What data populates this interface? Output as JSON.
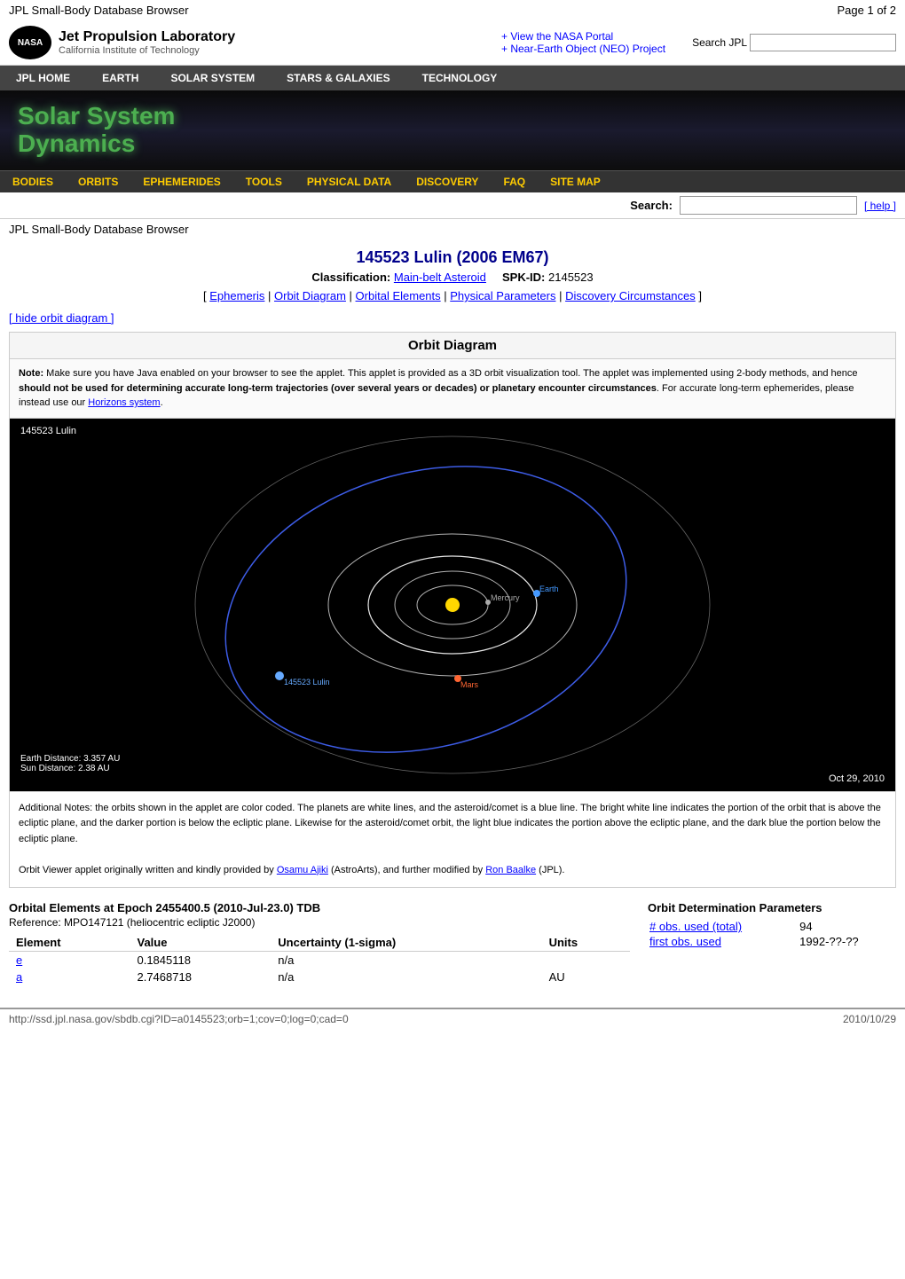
{
  "header": {
    "page_title": "JPL Small-Body Database Browser",
    "page_num": "Page 1 of 2",
    "nasa_label": "NASA",
    "jpl_main": "Jet Propulsion Laboratory",
    "jpl_sub": "California Institute of Technology",
    "nasa_link1": "+ View the NASA Portal",
    "nasa_link2": "+ Near-Earth Object (NEO) Project",
    "search_jpl_label": "Search JPL"
  },
  "main_nav": {
    "items": [
      {
        "label": "JPL HOME",
        "href": "#"
      },
      {
        "label": "EARTH",
        "href": "#"
      },
      {
        "label": "SOLAR SYSTEM",
        "href": "#"
      },
      {
        "label": "STARS & GALAXIES",
        "href": "#"
      },
      {
        "label": "TECHNOLOGY",
        "href": "#"
      }
    ]
  },
  "banner": {
    "title_line1": "Solar System",
    "title_line2": "Dynamics"
  },
  "sub_nav": {
    "items": [
      {
        "label": "BODIES",
        "href": "#"
      },
      {
        "label": "ORBITS",
        "href": "#"
      },
      {
        "label": "EPHEMERIDES",
        "href": "#"
      },
      {
        "label": "TOOLS",
        "href": "#"
      },
      {
        "label": "PHYSICAL DATA",
        "href": "#"
      },
      {
        "label": "DISCOVERY",
        "href": "#"
      },
      {
        "label": "FAQ",
        "href": "#"
      },
      {
        "label": "SITE MAP",
        "href": "#"
      }
    ]
  },
  "search_bar": {
    "label": "Search:",
    "help_link": "[ help ]"
  },
  "breadcrumb": "JPL Small-Body Database Browser",
  "asteroid": {
    "title": "145523 Lulin (2006 EM67)",
    "classification_label": "Classification:",
    "classification_value": "Main-belt Asteroid",
    "spk_label": "SPK-ID:",
    "spk_value": "2145523",
    "nav_links": [
      {
        "label": "Ephemeris"
      },
      {
        "label": "Orbit Diagram"
      },
      {
        "label": "Orbital Elements"
      },
      {
        "label": "Physical Parameters"
      },
      {
        "label": "Discovery Circumstances"
      }
    ]
  },
  "orbit_diagram": {
    "hide_link": "[ hide orbit diagram ]",
    "title": "Orbit Diagram",
    "note": "Note: Make sure you have Java enabled on your browser to see the applet. This applet is provided as a 3D orbit visualization tool. The applet was implemented using 2-body methods, and hence should not be used for determining accurate long-term trajectories (over several years or decades) or planetary encounter circumstances. For accurate long-term ephemerides, please instead use our Horizons system.",
    "horizons_link": "Horizons system",
    "label_asteroid": "145523 Lulin",
    "label_date": "Oct 29, 2010",
    "earth_distance": "Earth Distance: 3.357 AU",
    "sun_distance": "Sun Distance: 2.38 AU",
    "footer_note1": "Additional Notes: the orbits shown in the applet are color coded. The planets are white lines, and the asteroid/comet is a blue line. The bright white line indicates the portion of the orbit that is above the ecliptic plane, and the darker portion is below the ecliptic plane. Likewise for the asteroid/comet orbit, the light blue indicates the portion above the ecliptic plane, and the dark blue the portion below the ecliptic plane.",
    "footer_note2": "Orbit Viewer applet originally written and kindly provided by Osamu Ajiki (AstroArts), and further modified by Ron Baalke (JPL).",
    "osamu_link": "Osamu Ajiki",
    "ron_link": "Ron Baalke"
  },
  "orbital_elements": {
    "header": "Orbital Elements at Epoch 2455400.5 (2010-Jul-23.0) TDB",
    "reference": "Reference: MPO147121 (heliocentric ecliptic J2000)",
    "columns": [
      "Element",
      "Value",
      "Uncertainty (1-sigma)",
      "Units"
    ],
    "rows": [
      {
        "element": "e",
        "value": "0.1845118",
        "uncertainty": "n/a",
        "units": ""
      },
      {
        "element": "a",
        "value": "2.7468718",
        "uncertainty": "n/a",
        "units": "AU"
      }
    ]
  },
  "orbit_determination": {
    "header": "Orbit Determination Parameters",
    "obs_used_label": "# obs. used (total)",
    "obs_used_value": "94",
    "first_obs_label": "first obs. used",
    "first_obs_value": "1992-??-??"
  },
  "footer": {
    "url": "http://ssd.jpl.nasa.gov/sbdb.cgi?ID=a0145523;orb=1;cov=0;log=0;cad=0",
    "date": "2010/10/29"
  }
}
